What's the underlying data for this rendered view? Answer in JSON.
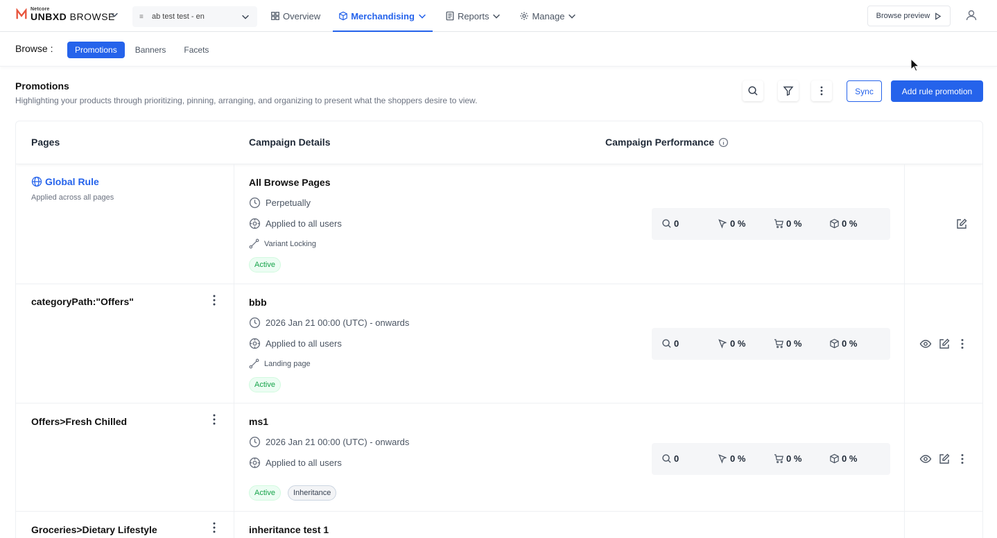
{
  "brand": {
    "small": "Netcore",
    "main_bold": "UNBXD",
    "main_light": " BROWSE"
  },
  "site_select": {
    "value": "ab test test - en"
  },
  "nav": [
    {
      "label": "Overview",
      "icon": "grid-icon"
    },
    {
      "label": "Merchandising",
      "icon": "cube-icon"
    },
    {
      "label": "Reports",
      "icon": "report-icon"
    },
    {
      "label": "Manage",
      "icon": "gear-icon"
    }
  ],
  "browse_preview": {
    "label": "Browse preview"
  },
  "subnav": {
    "label": "Browse :",
    "tabs": [
      "Promotions",
      "Banners",
      "Facets"
    ]
  },
  "header": {
    "title": "Promotions",
    "subtitle": "Highlighting your products through prioritizing, pinning, arranging, and organizing to present what the shoppers desire to view.",
    "sync_label": "Sync",
    "add_label": "Add rule promotion"
  },
  "table": {
    "columns": [
      "Pages",
      "Campaign Details",
      "Campaign Performance"
    ],
    "rows": [
      {
        "page": "Global Rule",
        "page_desc": "Applied across all pages",
        "campaign": "All Browse Pages",
        "schedule": "Perpetually",
        "audience": "Applied to all users",
        "extra": "Variant Locking",
        "badges": [
          "Active"
        ],
        "metrics": [
          "0",
          "0 %",
          "0 %",
          "0 %"
        ]
      },
      {
        "page": "categoryPath:\"Offers\"",
        "campaign": "bbb",
        "schedule": "2026 Jan 21 00:00 (UTC) - onwards",
        "audience": "Applied to all users",
        "extra": "Landing page",
        "badges": [
          "Active"
        ],
        "metrics": [
          "0",
          "0 %",
          "0 %",
          "0 %"
        ]
      },
      {
        "page": "Offers>Fresh Chilled",
        "campaign": "ms1",
        "schedule": "2026 Jan 21 00:00 (UTC) - onwards",
        "audience": "Applied to all users",
        "badges": [
          "Active",
          "Inheritance"
        ],
        "metrics": [
          "0",
          "0 %",
          "0 %",
          "0 %"
        ]
      },
      {
        "page": "Groceries>Dietary Lifestyle",
        "campaign": "inheritance test 1"
      }
    ]
  },
  "colors": {
    "accent": "#2563eb",
    "active_green": "#16a34a",
    "brand_orange": "#e8553d"
  }
}
